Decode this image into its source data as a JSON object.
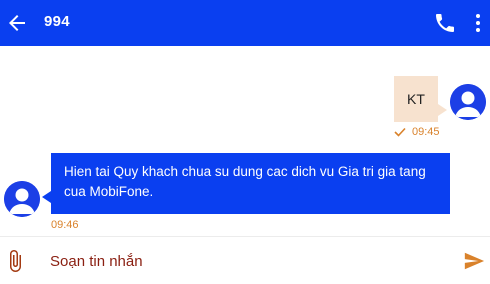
{
  "header": {
    "title": "994",
    "back_icon": "arrow-left-icon",
    "call_icon": "phone-icon",
    "menu_icon": "more-vertical-icon",
    "bar_color": "#0a3ff0"
  },
  "messages": [
    {
      "direction": "outgoing",
      "text": "KT",
      "time": "09:45",
      "status_icon": "check-icon",
      "bubble_color": "#f7e2cf"
    },
    {
      "direction": "incoming",
      "text": "Hien tai Quy khach chua su dung cac dich vu Gia tri gia tang cua MobiFone.",
      "time": "09:46",
      "bubble_color": "#0a3ff0"
    }
  ],
  "composer": {
    "placeholder": "Soạn tin nhắn",
    "attach_icon": "paperclip-icon",
    "send_icon": "send-icon",
    "accent_color": "#d9822b"
  }
}
